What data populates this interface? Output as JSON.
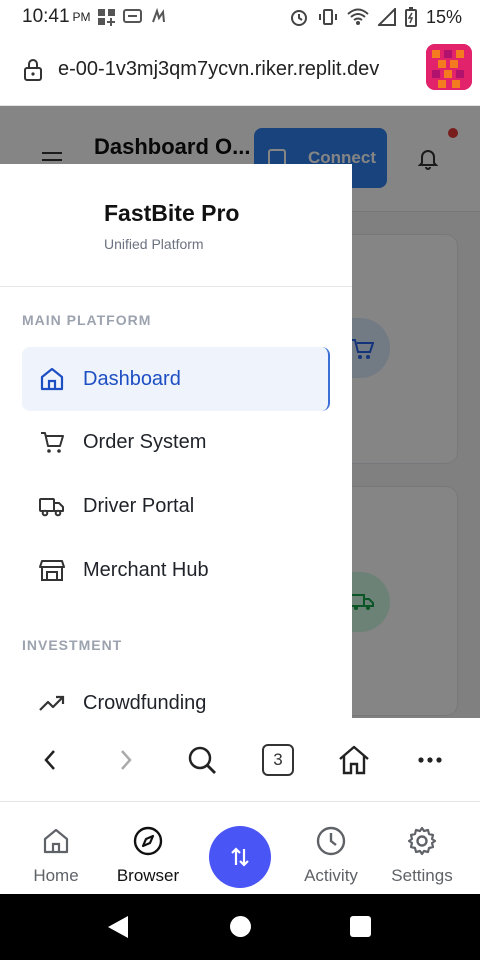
{
  "status_bar": {
    "time": "10:41",
    "ampm": "PM",
    "battery": "15%"
  },
  "browser": {
    "url": "e-00-1v3mj3qm7ycvn.riker.replit.dev",
    "tab_count": "3"
  },
  "page": {
    "header_title": "Dashboard O...",
    "connect_label": "Connect"
  },
  "drawer": {
    "brand_name": "FastBite Pro",
    "brand_subtitle": "Unified Platform",
    "sections": [
      {
        "label": "MAIN PLATFORM",
        "items": [
          {
            "label": "Dashboard",
            "icon": "home-icon",
            "active": true
          },
          {
            "label": "Order System",
            "icon": "cart-icon",
            "active": false
          },
          {
            "label": "Driver Portal",
            "icon": "truck-icon",
            "active": false
          },
          {
            "label": "Merchant Hub",
            "icon": "store-icon",
            "active": false
          }
        ]
      },
      {
        "label": "INVESTMENT",
        "items": [
          {
            "label": "Crowdfunding",
            "icon": "trending-up-icon",
            "active": false
          }
        ]
      }
    ]
  },
  "bottom_nav": {
    "home": "Home",
    "browser": "Browser",
    "activity": "Activity",
    "settings": "Settings"
  },
  "colors": {
    "accent": "#4a55f5",
    "active_nav_bg": "#eef3fc",
    "active_nav_text": "#1e4fc2",
    "connect_button": "#2f80ed",
    "favicon": "#e2226a"
  }
}
